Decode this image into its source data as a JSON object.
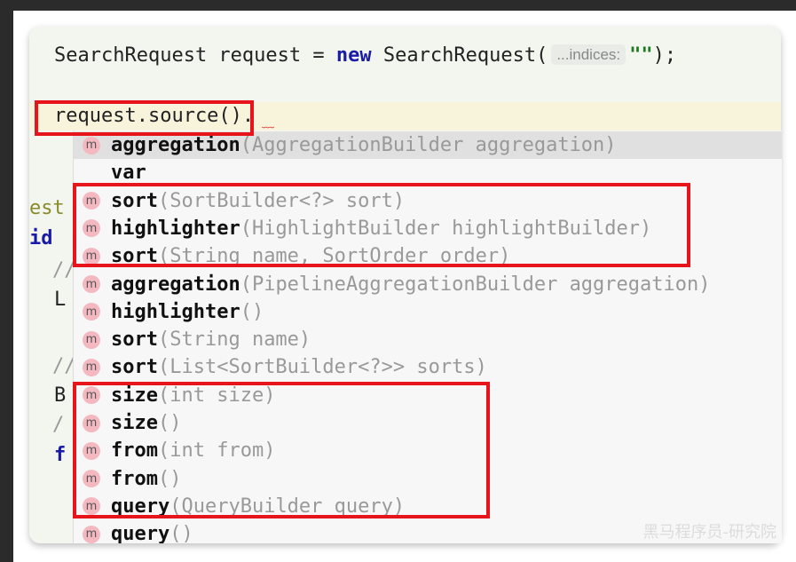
{
  "editor": {
    "line1": {
      "type": "SearchRequest",
      "var": " request = ",
      "keyword": "new",
      "ctor": " SearchRequest(",
      "hint": "...indices:",
      "string": "\"\"",
      "end": ");"
    },
    "line2": {
      "text": "request.source().",
      "selected_text": "request.source()",
      "dot": "."
    },
    "gutter": [
      "est",
      "id",
      "//",
      "L",
      "//",
      "B",
      "/",
      "f"
    ]
  },
  "completion": {
    "items": [
      {
        "name": "aggregation",
        "params": "(AggregationBuilder aggregation)",
        "icon": "method-icon",
        "selected": true
      },
      {
        "name": "var",
        "params": "",
        "icon": ""
      },
      {
        "name": "sort",
        "params": "(SortBuilder<?> sort)",
        "icon": "method-icon"
      },
      {
        "name": "highlighter",
        "params": "(HighlightBuilder highlightBuilder)",
        "icon": "method-icon"
      },
      {
        "name": "sort",
        "params": "(String name, SortOrder order)",
        "icon": "method-icon"
      },
      {
        "name": "aggregation",
        "params": "(PipelineAggregationBuilder aggregation)",
        "icon": "method-icon"
      },
      {
        "name": "highlighter",
        "params": "()",
        "icon": "method-icon"
      },
      {
        "name": "sort",
        "params": "(String name)",
        "icon": "method-icon"
      },
      {
        "name": "sort",
        "params": "(List<SortBuilder<?>> sorts)",
        "icon": "method-icon"
      },
      {
        "name": "size",
        "params": "(int size)",
        "icon": "method-icon"
      },
      {
        "name": "size",
        "params": "()",
        "icon": "method-icon"
      },
      {
        "name": "from",
        "params": "(int from)",
        "icon": "method-icon"
      },
      {
        "name": "from",
        "params": "()",
        "icon": "method-icon"
      },
      {
        "name": "query",
        "params": "(QueryBuilder query)",
        "icon": "method-icon"
      },
      {
        "name": "query",
        "params": "()",
        "icon": "method-icon"
      }
    ],
    "icon_letter": "m"
  },
  "annotation_color": "#e8141c",
  "watermark": "黑马程序员-研究院"
}
